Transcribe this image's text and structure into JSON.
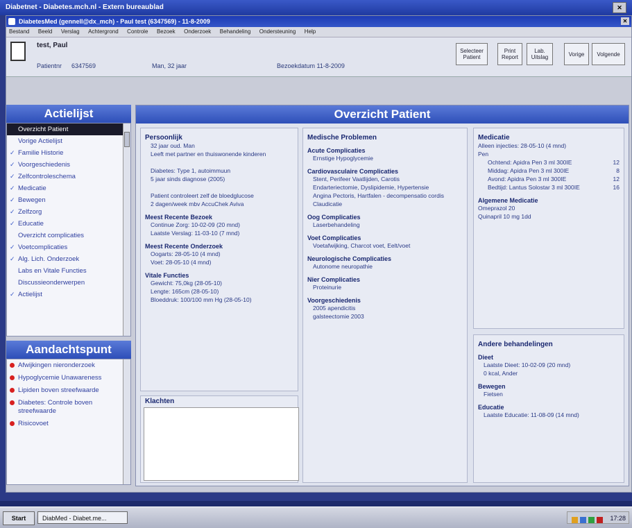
{
  "outer_title": "Diabetnet - Diabetes.mch.nl - Extern bureaublad",
  "app_title": "DiabetesMed (gennell@dx_mch) - Paul test (6347569) - 11-8-2009",
  "menu": [
    "Bestand",
    "Beeld",
    "Verslag",
    "Achtergrond",
    "Controle",
    "Bezoek",
    "Onderzoek",
    "Behandeling",
    "Ondersteuning",
    "Help"
  ],
  "patient": {
    "name": "test, Paul",
    "patient_label": "Patientnr",
    "patient_nr": "6347569",
    "sex_age": "Man, 32 jaar",
    "visit_date": "Bezoekdatum 11-8-2009"
  },
  "toolbar": {
    "select_patient": "Selecteer Patient",
    "print_report": "Print Report",
    "lab_results": "Lab. Uitslag",
    "next": "Volgende",
    "previous": "Vorige"
  },
  "actielijst": {
    "title": "Actielijst",
    "items": [
      {
        "label": "Overzicht Patient",
        "checked": false,
        "selected": true
      },
      {
        "label": "Vorige Actielijst",
        "checked": false,
        "selected": false
      },
      {
        "label": "Familie Historie",
        "checked": true,
        "selected": false
      },
      {
        "label": "Voorgeschiedenis",
        "checked": true,
        "selected": false
      },
      {
        "label": "Zelfcontroleschema",
        "checked": true,
        "selected": false
      },
      {
        "label": "Medicatie",
        "checked": true,
        "selected": false
      },
      {
        "label": "Bewegen",
        "checked": true,
        "selected": false
      },
      {
        "label": "Zelfzorg",
        "checked": true,
        "selected": false
      },
      {
        "label": "Educatie",
        "checked": true,
        "selected": false
      },
      {
        "label": "Overzicht complicaties",
        "checked": false,
        "selected": false
      },
      {
        "label": "Voetcomplicaties",
        "checked": true,
        "selected": false
      },
      {
        "label": "Alg. Lich. Onderzoek",
        "checked": true,
        "selected": false
      },
      {
        "label": "Labs en Vitale Functies",
        "checked": false,
        "selected": false
      },
      {
        "label": "Discussieonderwerpen",
        "checked": false,
        "selected": false
      },
      {
        "label": "Actielijst",
        "checked": true,
        "selected": false
      }
    ]
  },
  "aandachtspunt": {
    "title": "Aandachtspunt",
    "items": [
      "Afwijkingen nieronderzoek",
      "Hypoglycemie Unawareness",
      "Lipiden boven streefwaarde",
      "Diabetes: Controle boven streefwaarde",
      "Risicovoet"
    ]
  },
  "main": {
    "title": "Overzicht Patient",
    "persoonlijk": {
      "title": "Persoonlijk",
      "lines": [
        "32 jaar oud. Man",
        "Leeft met partner en thuiswonende kinderen",
        "",
        "Diabetes: Type 1, autoimmuun",
        "5 jaar sinds diagnose (2005)",
        "",
        "Patient controleert zelf de bloedglucose",
        "2 dagen/week mbv AccuChek Aviva"
      ]
    },
    "recent_bezoek": {
      "title": "Meest Recente Bezoek",
      "lines": [
        "Continue Zorg: 10-02-09 (20 mnd)",
        "Laatste Verslag: 11-03-10 (7 mnd)"
      ]
    },
    "recent_onderzoek": {
      "title": "Meest Recente Onderzoek",
      "lines": [
        "Oogarts: 28-05-10 (4 mnd)",
        "Voet: 28-05-10 (4 mnd)"
      ]
    },
    "vitale": {
      "title": "Vitale Functies",
      "lines": [
        "Gewicht: 75,0kg (28-05-10)",
        "Lengte: 165cm (28-05-10)",
        "Bloeddruk: 100/100 mm Hg (28-05-10)"
      ]
    },
    "klachten_title": "Klachten",
    "medische": {
      "title": "Medische Problemen",
      "groups": [
        {
          "title": "Acute Complicaties",
          "lines": [
            "Ernstige Hypoglycemie"
          ]
        },
        {
          "title": "Cardiovasculaire Complicaties",
          "lines": [
            "Stent, Perifeer Vaatlijden, Carotis",
            "Endarteriectomie, Dyslipidemie, Hypertensie",
            "Angina Pectoris, Hartfalen - decompensatio cordis",
            "Claudicatie"
          ]
        },
        {
          "title": "Oog Complicaties",
          "lines": [
            "Laserbehandeling"
          ]
        },
        {
          "title": "Voet Complicaties",
          "lines": [
            "Voetafwijking, Charcot voet, Eelt/voet"
          ]
        },
        {
          "title": "Neurologische Complicaties",
          "lines": [
            "Autonome neuropathie"
          ]
        },
        {
          "title": "Nier Complicaties",
          "lines": [
            "Proteinurie"
          ]
        },
        {
          "title": "Voorgeschiedenis",
          "lines": [
            "2005 apendicitis",
            "galsteectomie 2003"
          ]
        }
      ]
    },
    "medicatie": {
      "title": "Medicatie",
      "intro": "Alleen injecties: 28-05-10 (4 mnd)",
      "pen_label": "Pen",
      "rows": [
        {
          "name": "Ochtend: Apidra Pen 3 ml 300IE",
          "dose": "12"
        },
        {
          "name": "Middag: Apidra Pen 3 ml 300IE",
          "dose": "8"
        },
        {
          "name": "Avond: Apidra Pen 3 ml 300IE",
          "dose": "12"
        },
        {
          "name": "Bedtijd: Lantus Solostar 3 ml 300IE",
          "dose": "16"
        }
      ],
      "alg_title": "Algemene Medicatie",
      "alg_lines": [
        "Omeprazol 20",
        "Quinapril 10 mg 1dd"
      ]
    },
    "andere": {
      "title": "Andere behandelingen",
      "groups": [
        {
          "title": "Dieet",
          "lines": [
            "Laatste Dieet: 10-02-09 (20 mnd)",
            "0 kcal, Ander"
          ]
        },
        {
          "title": "Bewegen",
          "lines": [
            "Fietsen"
          ]
        },
        {
          "title": "Educatie",
          "lines": [
            "Laatste Educatie: 11-08-09 (14 mnd)"
          ]
        }
      ]
    }
  },
  "taskbar": {
    "start": "Start",
    "task": "DiabMed - Diabet.me...",
    "clock": "17:28"
  }
}
